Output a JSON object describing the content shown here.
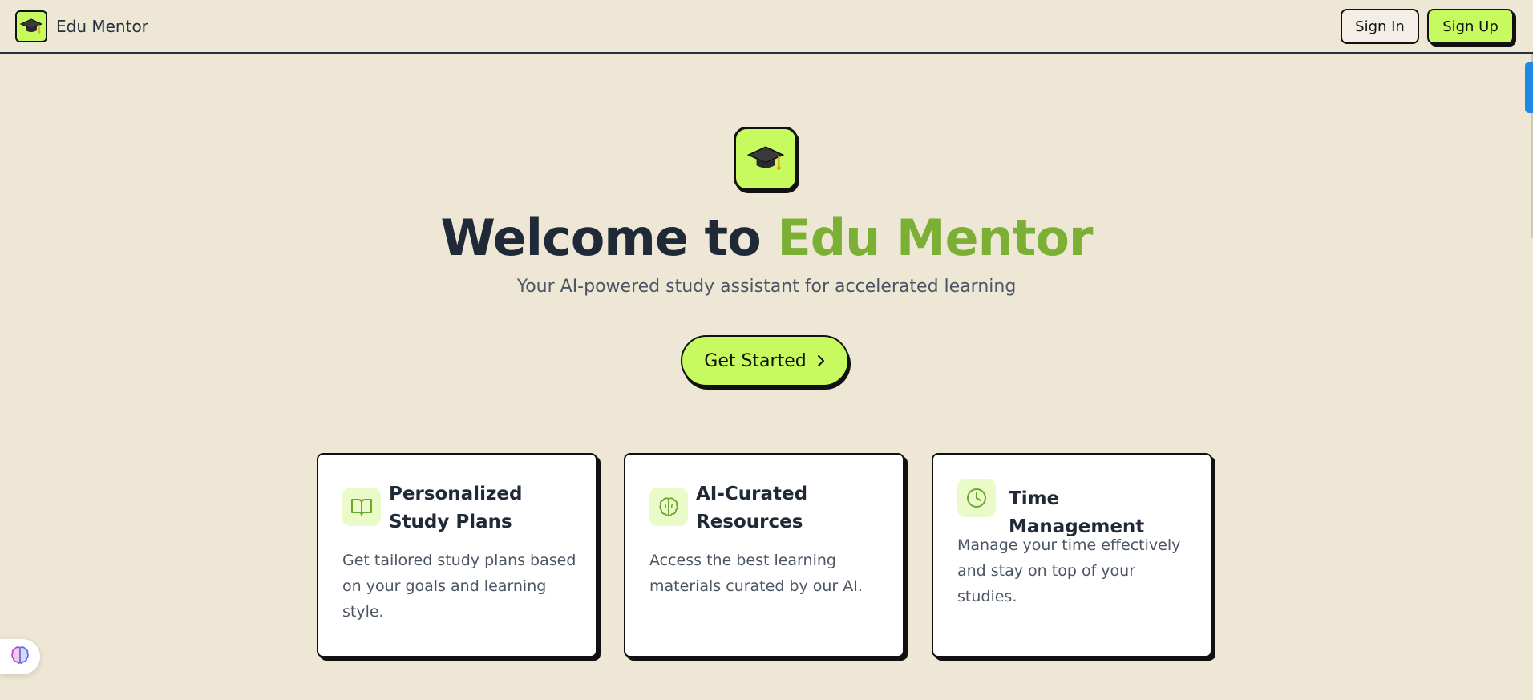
{
  "header": {
    "brand_name": "Edu Mentor",
    "sign_in_label": "Sign In",
    "sign_up_label": "Sign Up"
  },
  "hero": {
    "title_prefix": "Welcome to ",
    "title_accent": "Edu Mentor",
    "subtitle": "Your AI-powered study assistant for accelerated learning",
    "cta_label": "Get Started"
  },
  "features": [
    {
      "icon": "book-open-icon",
      "title": "Personalized Study Plans",
      "description": "Get tailored study plans based on your goals and learning style."
    },
    {
      "icon": "brain-icon",
      "title": "AI-Curated Resources",
      "description": "Access the best learning materials curated by our AI."
    },
    {
      "icon": "clock-icon",
      "title": "Time Management",
      "description": "Manage your time effectively and stay on top of your studies."
    }
  ],
  "colors": {
    "background": "#efe7d5",
    "accent_lime": "#c6fa5e",
    "accent_green_text": "#7cb034",
    "dark": "#1f2937"
  }
}
